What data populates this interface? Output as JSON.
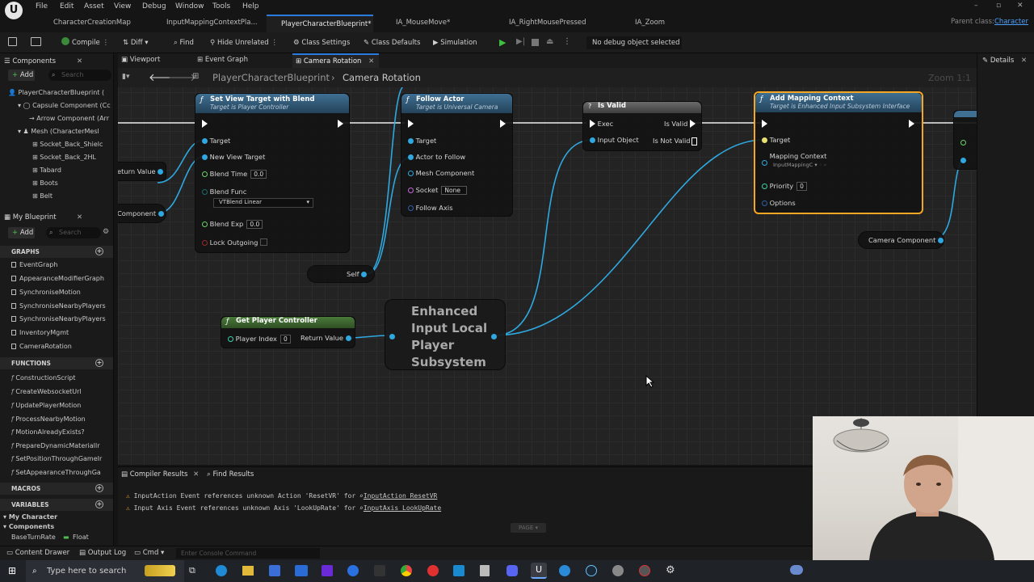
{
  "menu": [
    "File",
    "Edit",
    "Asset",
    "View",
    "Debug",
    "Window",
    "Tools",
    "Help"
  ],
  "doc_tabs": [
    {
      "label": "CharacterCreationMap",
      "active": false
    },
    {
      "label": "InputMappingContextPla...",
      "active": false
    },
    {
      "label": "PlayerCharacterBlueprint*",
      "active": true
    },
    {
      "label": "IA_MouseMove*",
      "active": false
    },
    {
      "label": "IA_RightMousePressed",
      "active": false
    },
    {
      "label": "IA_Zoom",
      "active": false
    }
  ],
  "parent_class": {
    "label": "Parent class:",
    "value": "Character"
  },
  "toolbar": {
    "compile": "Compile",
    "diff": "Diff",
    "find": "Find",
    "hide_unrelated": "Hide Unrelated",
    "class_settings": "Class Settings",
    "class_defaults": "Class Defaults",
    "simulation": "Simulation",
    "debug_select": "No debug object selected"
  },
  "components": {
    "tab": "Components",
    "add": "Add",
    "search_placeholder": "Search",
    "items": [
      "PlayerCharacterBlueprint (",
      "Capsule Component (Cc",
      "Arrow Component (Arr",
      "Mesh (CharacterMesl",
      "Socket_Back_Shielc",
      "Socket_Back_2HL",
      "Tabard",
      "Boots",
      "Belt"
    ]
  },
  "my_blueprint": {
    "tab": "My Blueprint",
    "add": "Add",
    "search_placeholder": "Search",
    "graphs_header": "GRAPHS",
    "graphs": [
      "EventGraph",
      "AppearanceModifierGraph",
      "SynchroniseMotion",
      "SynchroniseNearbyPlayers",
      "SynchroniseNearbyPlayers",
      "InventoryMgmt",
      "CameraRotation"
    ],
    "functions_header": "FUNCTIONS",
    "functions": [
      "ConstructionScript",
      "CreateWebsocketUrl",
      "UpdatePlayerMotion",
      "ProcessNearbyMotion",
      "MotionAlreadyExists?",
      "PrepareDynamicMaterialIr",
      "SetPositionThroughGameIr",
      "SetAppearanceThroughGa"
    ],
    "macros_header": "MACROS",
    "variables_header": "VARIABLES",
    "variables": [
      "My Character",
      "Components"
    ],
    "var_row": {
      "name": "BaseTurnRate",
      "type": "Float"
    }
  },
  "graph_tabs": {
    "viewport": "Viewport",
    "event_graph": "Event Graph",
    "camera_rotation": "Camera Rotation"
  },
  "breadcrumb": {
    "root": "PlayerCharacterBlueprint",
    "sep": "›",
    "leaf": "Camera Rotation"
  },
  "zoom": "Zoom 1:1",
  "nodes": {
    "set_view": {
      "title": "Set View Target with Blend",
      "subtitle": "Target is Player Controller",
      "target": "Target",
      "new_view_target": "New View Target",
      "blend_time": "Blend Time",
      "blend_time_val": "0.0",
      "blend_func": "Blend Func",
      "blend_func_val": "VTBlend Linear",
      "blend_exp": "Blend Exp",
      "blend_exp_val": "0.0",
      "lock_outgoing": "Lock Outgoing"
    },
    "follow_actor": {
      "title": "Follow Actor",
      "subtitle": "Target is Universal Camera",
      "target": "Target",
      "actor_to_follow": "Actor to Follow",
      "mesh_component": "Mesh Component",
      "socket": "Socket",
      "socket_val": "None",
      "follow_axis": "Follow Axis"
    },
    "is_valid": {
      "title": "Is Valid",
      "exec": "Exec",
      "input_object": "Input Object",
      "is_valid_out": "Is Valid",
      "is_not_valid": "Is Not Valid"
    },
    "add_mapping": {
      "title": "Add Mapping Context",
      "subtitle": "Target is Enhanced Input Subsystem Interface",
      "target": "Target",
      "mapping_context": "Mapping Context",
      "mapping_val": "InputMappingC",
      "priority": "Priority",
      "priority_val": "0",
      "options": "Options"
    },
    "return_value": "eturn Value",
    "component": "Component",
    "self": "Self",
    "get_pc": {
      "title": "Get Player Controller",
      "player_index": "Player Index",
      "player_index_val": "0",
      "return_value": "Return Value"
    },
    "subsystem": {
      "title": "Enhanced Input Local Player Subsystem"
    },
    "camera_component": "Camera Component"
  },
  "bottom": {
    "tab_compiler": "Compiler Results",
    "tab_find": "Find Results",
    "messages": [
      {
        "text": "InputAction Event references unknown Action 'ResetVR' for",
        "link": "InputAction ResetVR"
      },
      {
        "text": "Input Axis Event references unknown Axis 'LookUpRate' for",
        "link": "InputAxis LookUpRate"
      }
    ],
    "page": "PAGE"
  },
  "status": {
    "content_drawer": "Content Drawer",
    "output_log": "Output Log",
    "cmd": "Cmd",
    "console_placeholder": "Enter Console Command"
  },
  "details": {
    "tab": "Details"
  },
  "taskbar": {
    "search_placeholder": "Type here to search"
  }
}
